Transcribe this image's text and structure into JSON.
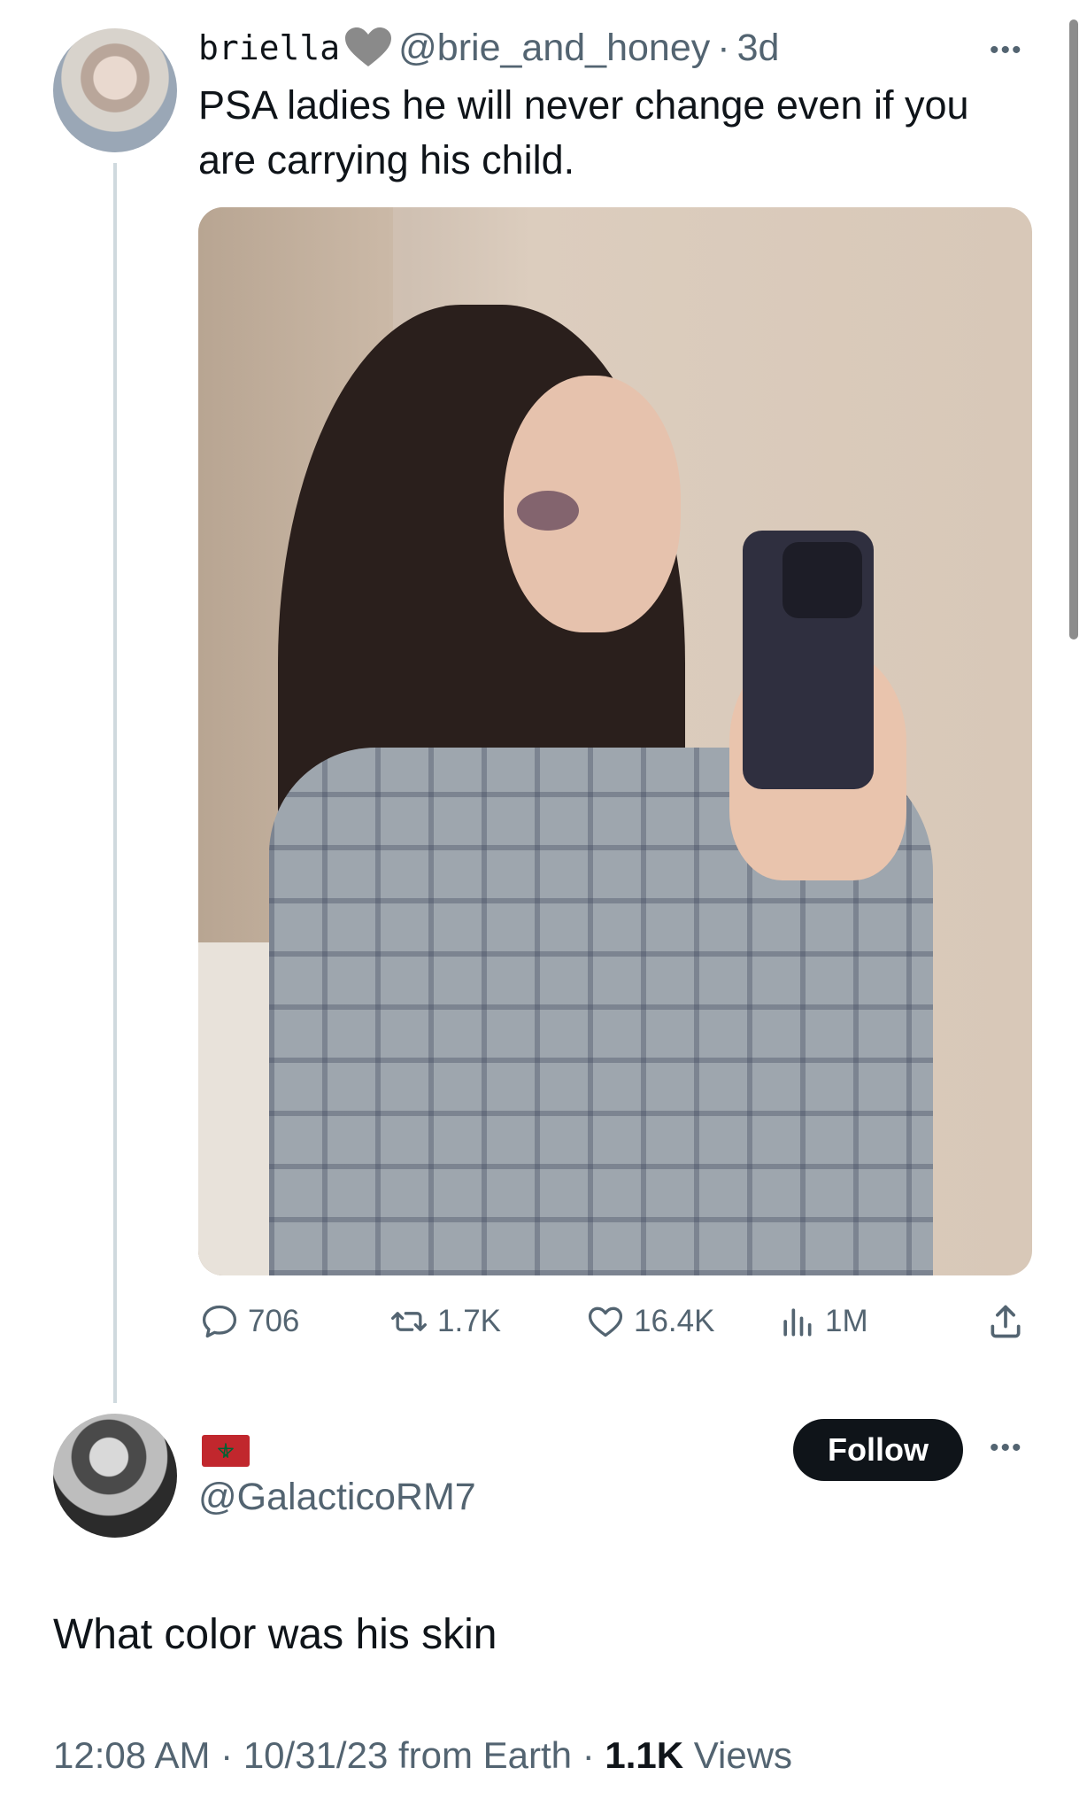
{
  "tweet": {
    "author": {
      "name": "briella",
      "name_emoji": "grey-heart",
      "handle": "@brie_and_honey",
      "time": "3d"
    },
    "separator": "·",
    "more": "•••",
    "text": "PSA ladies he will never change even if you are carrying his child.",
    "actions": {
      "replies": "706",
      "reposts": "1.7K",
      "likes": "16.4K",
      "views": "1M"
    }
  },
  "reply": {
    "flag": "morocco",
    "handle": "@GalacticoRM7",
    "follow_label": "Follow",
    "more": "•••",
    "text": "What color was his skin",
    "meta": {
      "time": "12:08 AM",
      "date": "10/31/23",
      "source": "from Earth",
      "views_count": "1.1K",
      "views_label": "Views",
      "separator": "·"
    }
  },
  "colors": {
    "text": "#0f1419",
    "secondary": "#536471",
    "thread_line": "#cfd9de",
    "follow_bg": "#0f1419"
  }
}
